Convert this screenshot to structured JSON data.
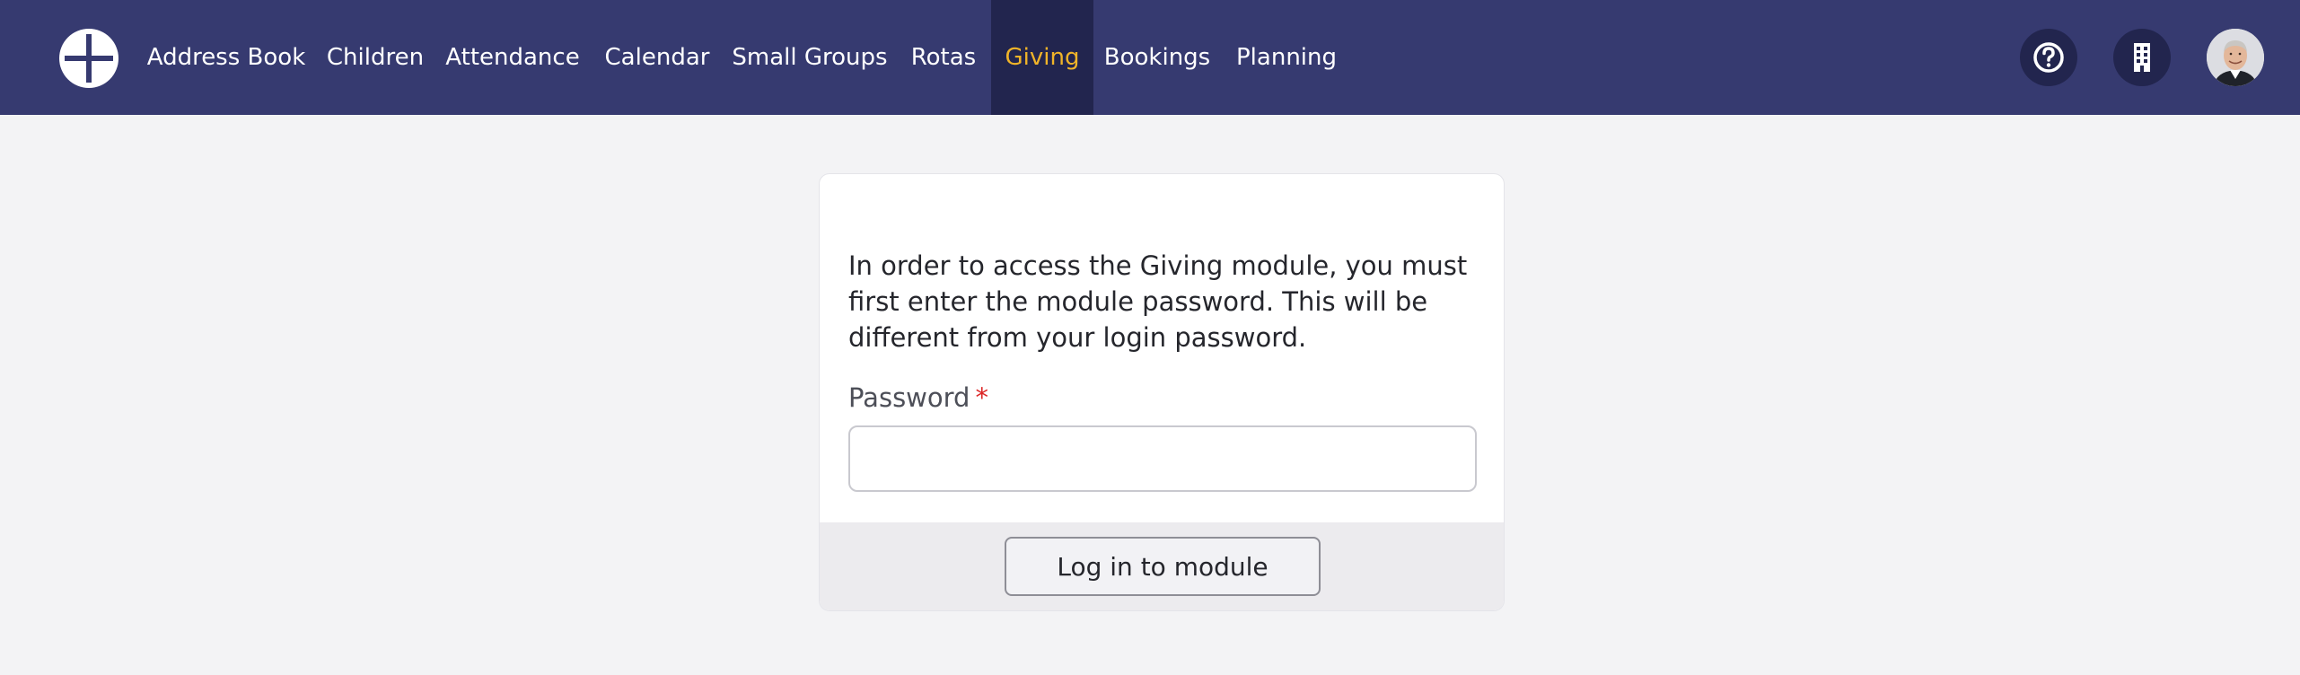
{
  "nav": {
    "items": [
      {
        "label": "Address Book",
        "active": false
      },
      {
        "label": "Children",
        "active": false
      },
      {
        "label": "Attendance",
        "active": false
      },
      {
        "label": "Calendar",
        "active": false
      },
      {
        "label": "Small Groups",
        "active": false
      },
      {
        "label": "Rotas",
        "active": false
      },
      {
        "label": "Giving",
        "active": true
      },
      {
        "label": "Bookings",
        "active": false
      },
      {
        "label": "Planning",
        "active": false
      }
    ]
  },
  "header_icons": {
    "help": "help-icon",
    "organisation": "building-icon",
    "user": "avatar"
  },
  "colors": {
    "header_bg": "#363a70",
    "active_nav_bg": "#22254e",
    "active_nav_text": "#f0b429",
    "page_bg": "#f3f3f5",
    "required_star": "#dc2626"
  },
  "login": {
    "intro": "In order to access the Giving module, you must first enter the module password. This will be different from your login password.",
    "password_label": "Password",
    "required_mark": "*",
    "password_value": "",
    "submit_label": "Log in to module"
  }
}
